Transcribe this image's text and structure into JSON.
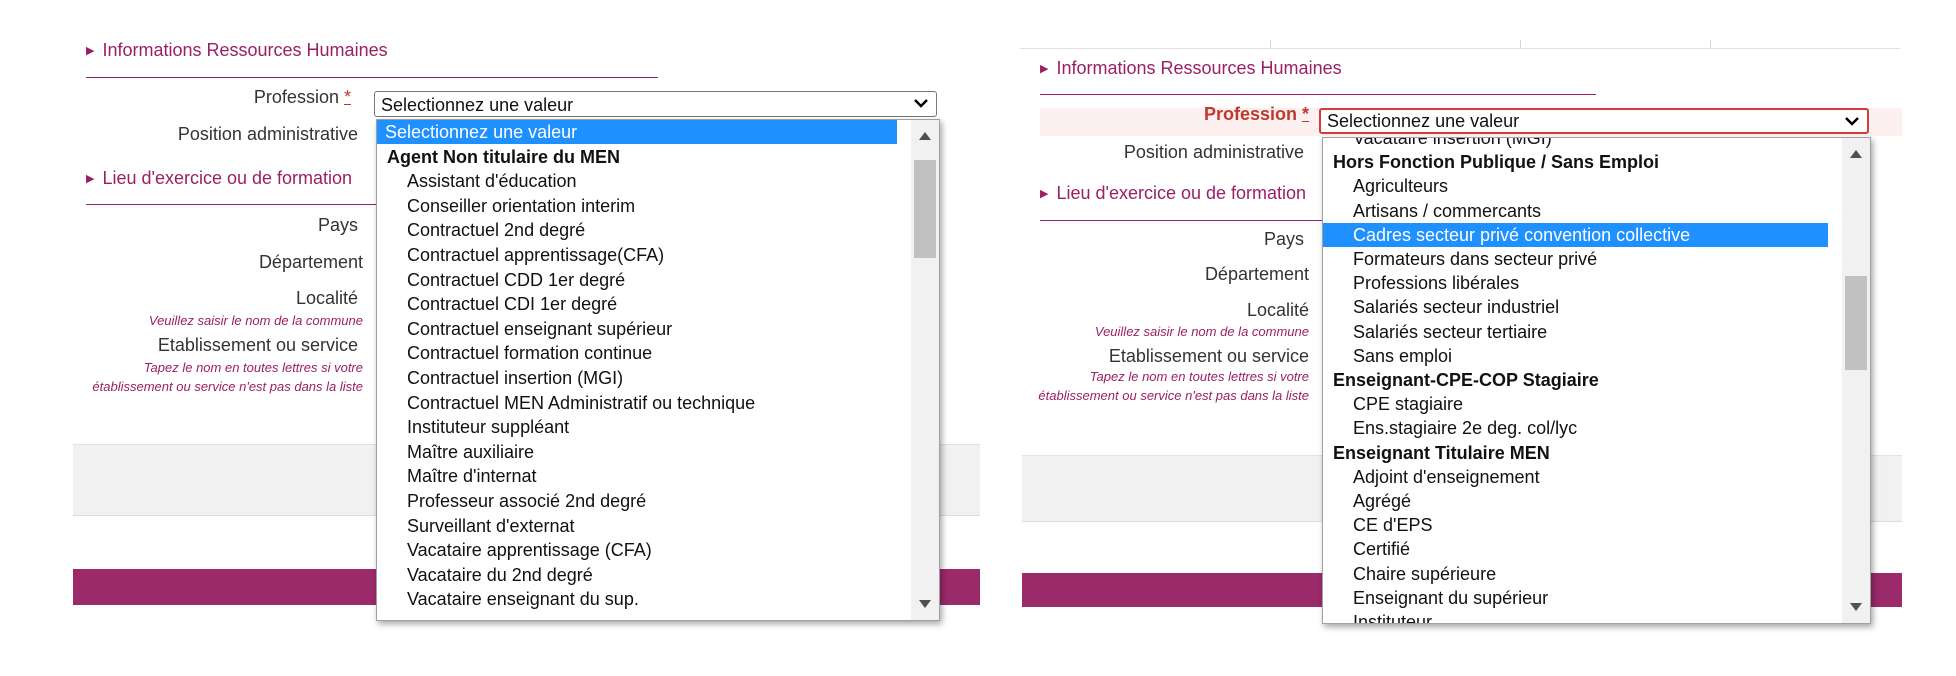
{
  "left": {
    "section_hr": "Informations Ressources Humaines",
    "section_lieu": "Lieu d'exercice ou de formation",
    "labels": {
      "profession": "Profession",
      "required_mark": "*",
      "position": "Position administrative",
      "pays": "Pays",
      "departement": "Département",
      "localite": "Localité",
      "localite_hint": "Veuillez saisir le nom de la commune",
      "etablissement": "Etablissement ou service",
      "etablissement_hint": "Tapez le nom en toutes lettres si votre établissement ou service n'est pas dans la liste"
    },
    "select_value": "Selectionnez une valeur",
    "options": [
      {
        "label": "Selectionnez une valeur",
        "kind": "first",
        "selected": true
      },
      {
        "label": "Agent Non titulaire du MEN",
        "kind": "group"
      },
      {
        "label": "Assistant d'éducation",
        "kind": "item"
      },
      {
        "label": "Conseiller orientation interim",
        "kind": "item"
      },
      {
        "label": "Contractuel 2nd degré",
        "kind": "item"
      },
      {
        "label": "Contractuel apprentissage(CFA)",
        "kind": "item"
      },
      {
        "label": "Contractuel CDD 1er degré",
        "kind": "item"
      },
      {
        "label": "Contractuel CDI 1er degré",
        "kind": "item"
      },
      {
        "label": "Contractuel enseignant supérieur",
        "kind": "item"
      },
      {
        "label": "Contractuel formation continue",
        "kind": "item"
      },
      {
        "label": "Contractuel insertion (MGI)",
        "kind": "item"
      },
      {
        "label": "Contractuel MEN Administratif ou technique",
        "kind": "item"
      },
      {
        "label": "Instituteur suppléant",
        "kind": "item"
      },
      {
        "label": "Maître auxiliaire",
        "kind": "item"
      },
      {
        "label": "Maître d'internat",
        "kind": "item"
      },
      {
        "label": "Professeur associé 2nd degré",
        "kind": "item"
      },
      {
        "label": "Surveillant d'externat",
        "kind": "item"
      },
      {
        "label": "Vacataire apprentissage (CFA)",
        "kind": "item"
      },
      {
        "label": "Vacataire du 2nd degré",
        "kind": "item"
      },
      {
        "label": "Vacataire enseignant du sup.",
        "kind": "item"
      }
    ]
  },
  "right": {
    "section_hr": "Informations Ressources Humaines",
    "section_lieu": "Lieu d'exercice ou de formation",
    "labels": {
      "profession": "Profession",
      "required_mark": "*",
      "position": "Position administrative",
      "pays": "Pays",
      "departement": "Département",
      "localite": "Localité",
      "localite_hint": "Veuillez saisir le nom de la commune",
      "etablissement": "Etablissement ou service",
      "etablissement_hint": "Tapez le nom en toutes lettres si votre établissement ou service n'est pas dans la liste"
    },
    "select_value": "Selectionnez une valeur",
    "options": [
      {
        "label": "Vacataire insertion (MGI)",
        "kind": "item"
      },
      {
        "label": "Hors Fonction Publique / Sans Emploi",
        "kind": "group"
      },
      {
        "label": "Agriculteurs",
        "kind": "item"
      },
      {
        "label": "Artisans / commercants",
        "kind": "item"
      },
      {
        "label": "Cadres secteur privé convention collective",
        "kind": "item",
        "selected": true
      },
      {
        "label": "Formateurs dans secteur privé",
        "kind": "item"
      },
      {
        "label": "Professions libérales",
        "kind": "item"
      },
      {
        "label": "Salariés secteur industriel",
        "kind": "item"
      },
      {
        "label": "Salariés secteur tertiaire",
        "kind": "item"
      },
      {
        "label": "Sans emploi",
        "kind": "item"
      },
      {
        "label": "Enseignant-CPE-COP Stagiaire",
        "kind": "group"
      },
      {
        "label": "CPE stagiaire",
        "kind": "item"
      },
      {
        "label": "Ens.stagiaire 2e deg. col/lyc",
        "kind": "item"
      },
      {
        "label": "Enseignant Titulaire MEN",
        "kind": "group"
      },
      {
        "label": "Adjoint d'enseignement",
        "kind": "item"
      },
      {
        "label": "Agrégé",
        "kind": "item"
      },
      {
        "label": "CE d'EPS",
        "kind": "item"
      },
      {
        "label": "Certifié",
        "kind": "item"
      },
      {
        "label": "Chaire supérieure",
        "kind": "item"
      },
      {
        "label": "Enseignant du supérieur",
        "kind": "item"
      },
      {
        "label": "Instituteur",
        "kind": "item"
      }
    ]
  },
  "colors": {
    "accent": "#9b1f65",
    "selected_bg": "#1e90ff",
    "error": "#d63a3a"
  }
}
